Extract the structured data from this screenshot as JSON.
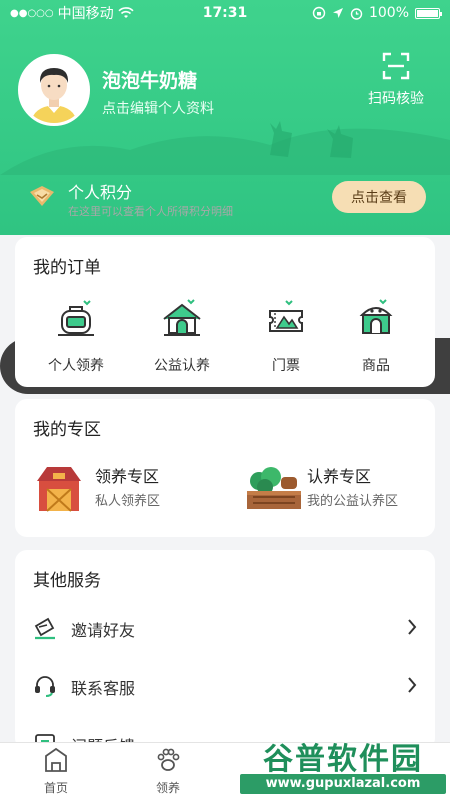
{
  "status_bar": {
    "carrier": "中国移动",
    "time": "17:31",
    "battery": "100%",
    "battery_level": 1.0
  },
  "profile": {
    "username": "泡泡牛奶糖",
    "edit_hint": "点击编辑个人资料",
    "scan_label": "扫码核验"
  },
  "points": {
    "title": "个人积分",
    "subtitle": "在这里可以查看个人所得积分明细",
    "button": "点击查看"
  },
  "orders": {
    "title": "我的订单",
    "items": [
      {
        "label": "个人领养",
        "icon": "cage-icon"
      },
      {
        "label": "公益认养",
        "icon": "pet-house-icon"
      },
      {
        "label": "门票",
        "icon": "ticket-icon"
      },
      {
        "label": "商品",
        "icon": "shop-icon"
      }
    ]
  },
  "zone": {
    "title": "我的专区",
    "items": [
      {
        "title": "领养专区",
        "subtitle": "私人领养区",
        "icon": "barn-icon"
      },
      {
        "title": "认养专区",
        "subtitle": "我的公益认养区",
        "icon": "garden-icon"
      }
    ]
  },
  "services": {
    "title": "其他服务",
    "items": [
      {
        "label": "邀请好友",
        "icon": "invite-icon"
      },
      {
        "label": "联系客服",
        "icon": "headset-icon"
      },
      {
        "label": "问题反馈",
        "icon": "feedback-icon"
      }
    ]
  },
  "tabbar": {
    "items": [
      {
        "label": "首页",
        "icon": "home-icon"
      },
      {
        "label": "领养",
        "icon": "paw-icon"
      }
    ]
  },
  "watermark": {
    "title": "谷普软件园",
    "url": "www.gupuxlazal.com"
  },
  "colors": {
    "brand_green": "#34c98a",
    "points_bg": "#3f3f3f",
    "points_button": "#f6deb4"
  }
}
